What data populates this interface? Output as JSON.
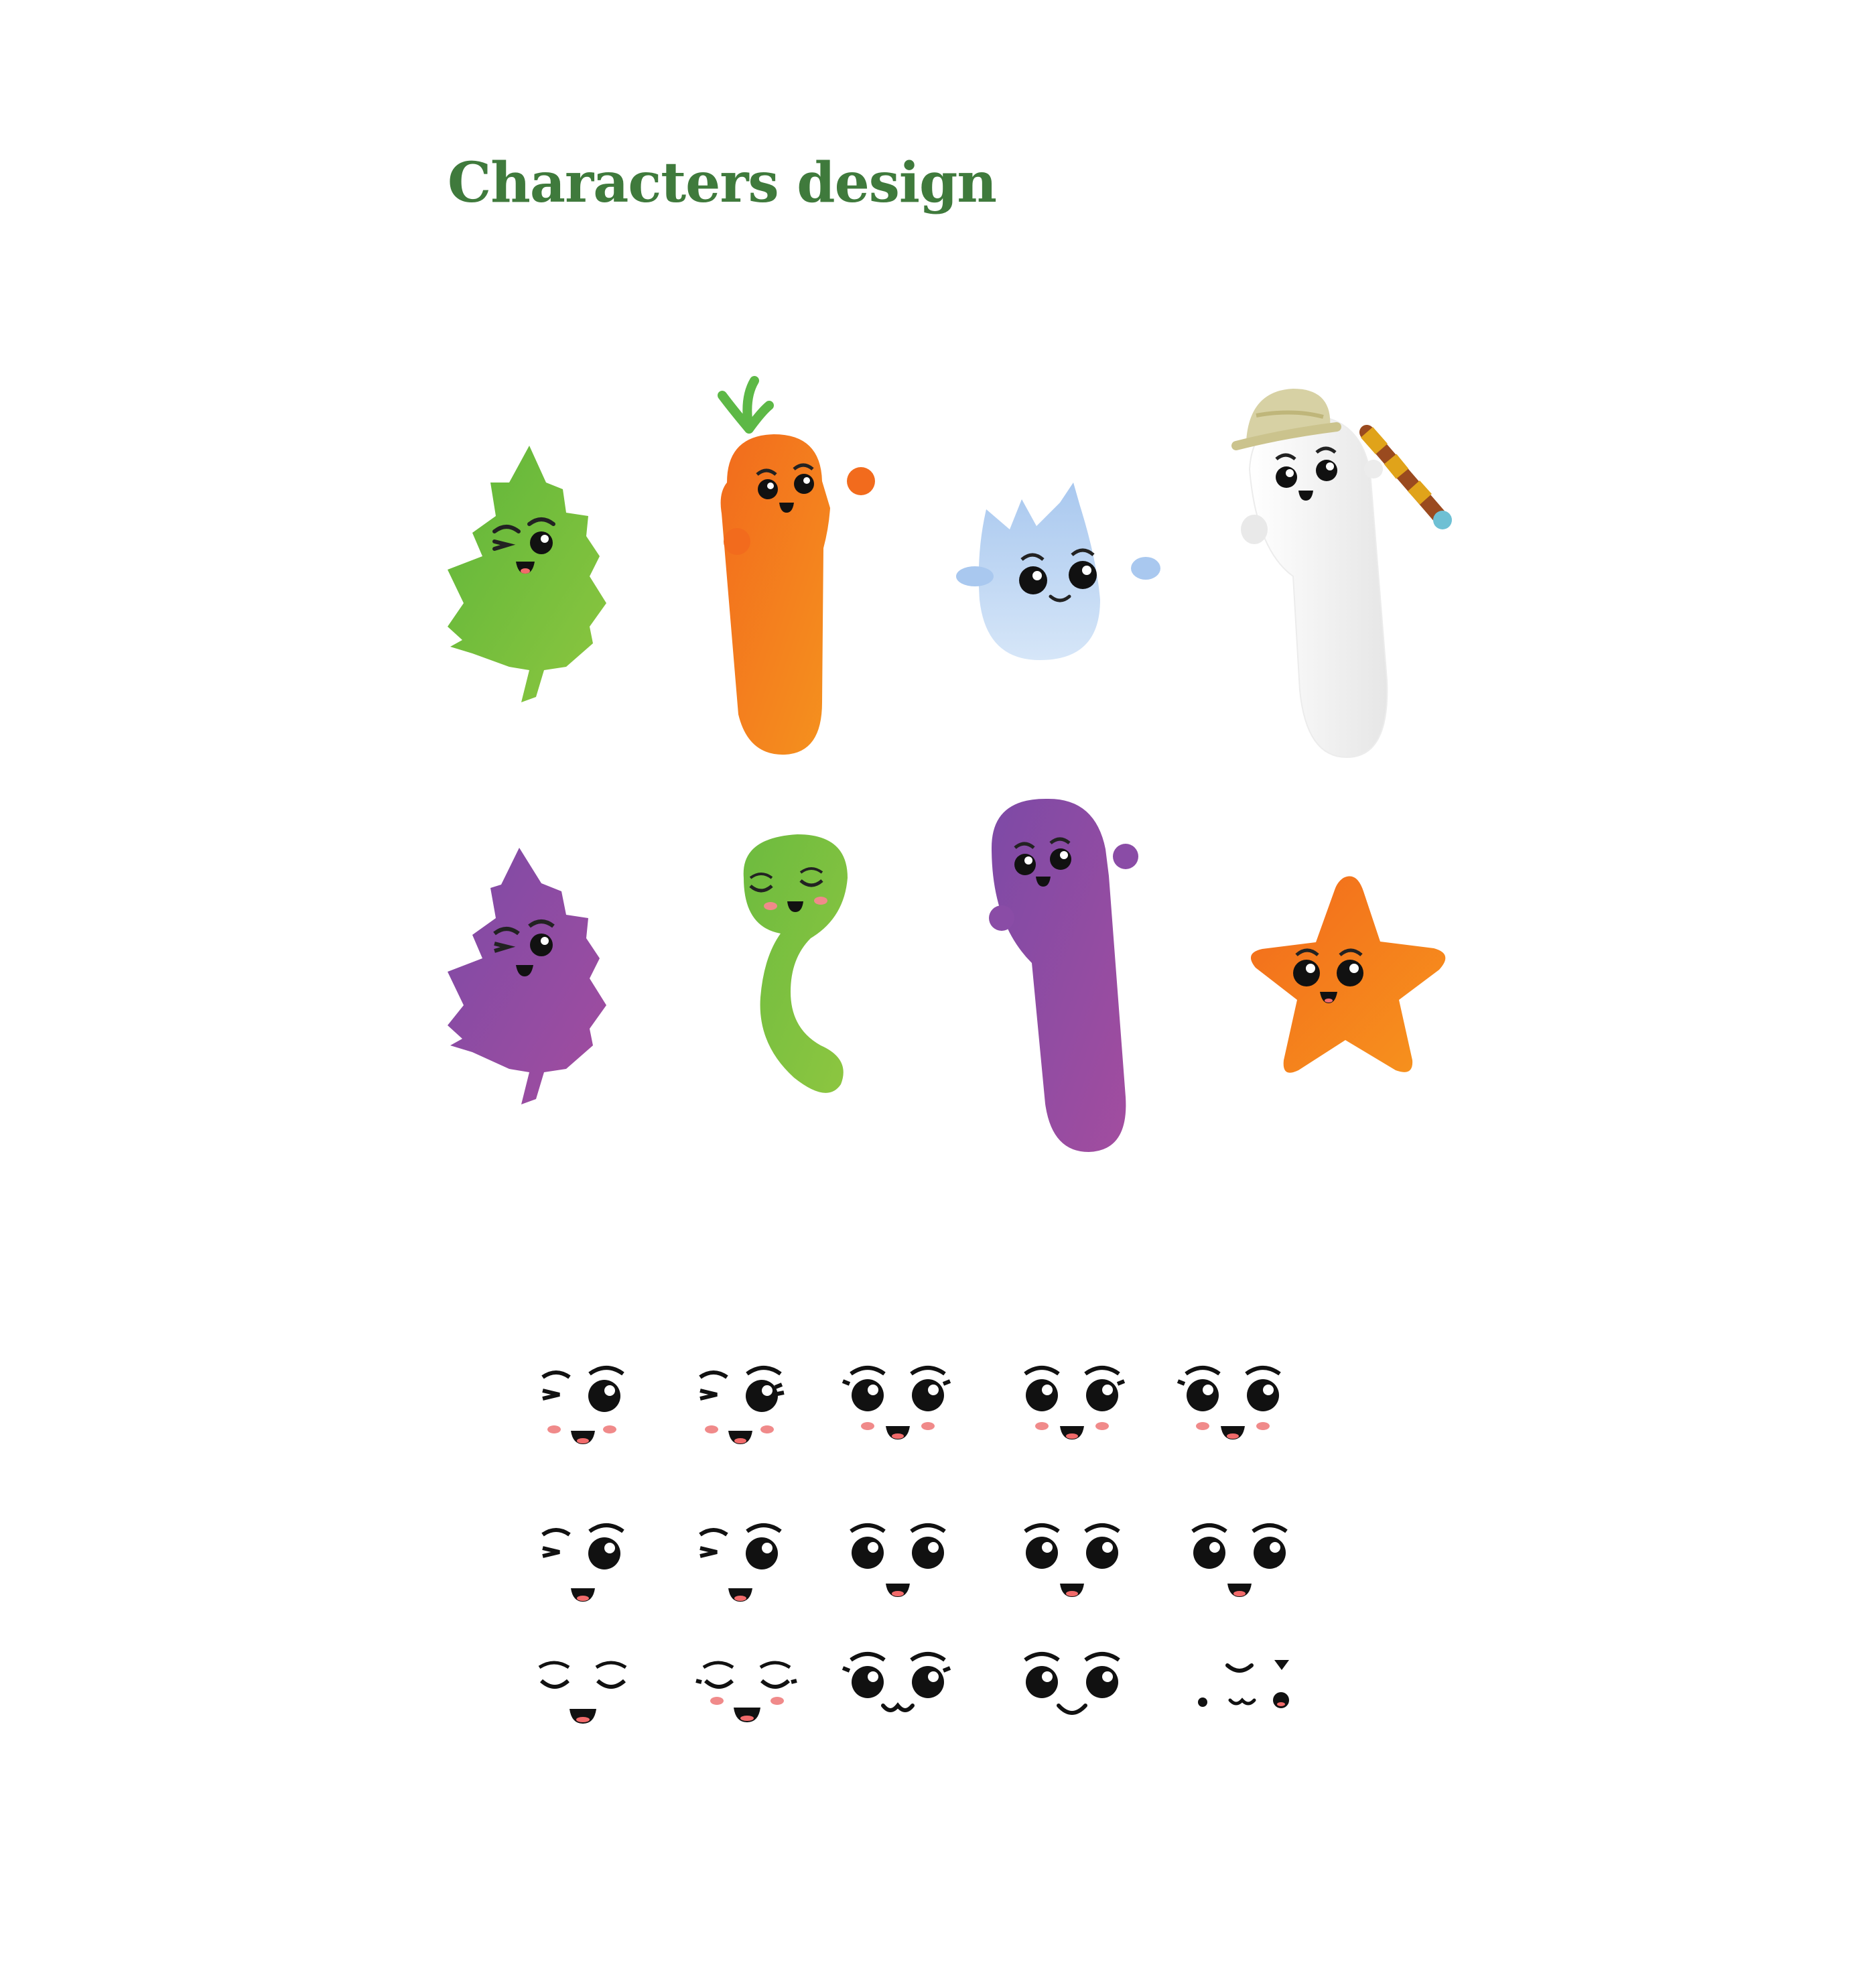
{
  "page": {
    "title": "Characters design",
    "title_color": "#3f7a3c",
    "background": "#ffffff"
  },
  "characters": [
    {
      "name": "green-leaf",
      "color": "#6cbf3f"
    },
    {
      "name": "orange-carrot",
      "color": "#f07a1f"
    },
    {
      "name": "blue-water-drop",
      "color": "#b9d4f2"
    },
    {
      "name": "white-explorer",
      "color": "#f2f2f2"
    },
    {
      "name": "purple-leaf",
      "color": "#8a4fa5"
    },
    {
      "name": "green-sprout",
      "color": "#79c142"
    },
    {
      "name": "purple-worm",
      "color": "#8f4aa2"
    },
    {
      "name": "orange-starfish",
      "color": "#f27a1e"
    }
  ],
  "face_sheet": {
    "rows": 3,
    "columns": 5
  }
}
